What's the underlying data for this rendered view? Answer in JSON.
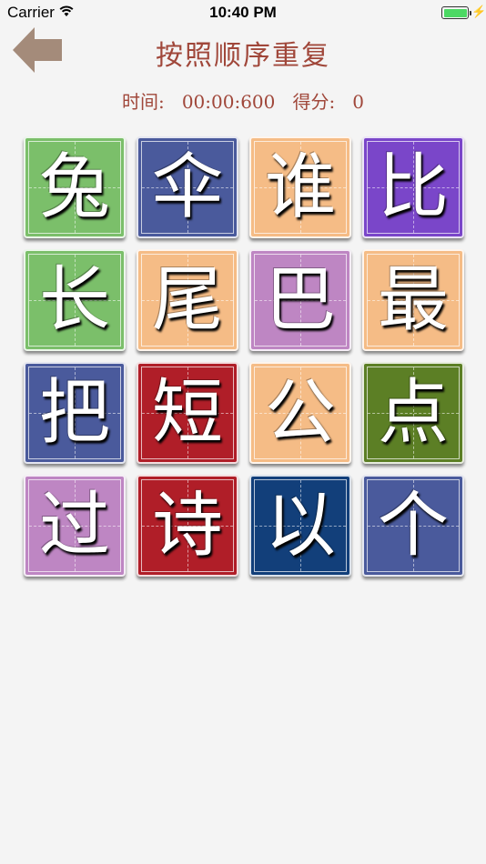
{
  "status_bar": {
    "carrier": "Carrier",
    "time": "10:40 PM"
  },
  "header": {
    "title": "按照顺序重复",
    "time_label": "时间:",
    "time_value": "00:00:600",
    "score_label": "得分:",
    "score_value": "0",
    "accent_color": "#a0473a",
    "back_arrow_color": "#a48b7a"
  },
  "tiles": [
    {
      "char": "兔",
      "color": "#7bbf6a"
    },
    {
      "char": "伞",
      "color": "#4a5a9c"
    },
    {
      "char": "谁",
      "color": "#f5bc86"
    },
    {
      "char": "比",
      "color": "#7a46c9"
    },
    {
      "char": "长",
      "color": "#7bbf6a"
    },
    {
      "char": "尾",
      "color": "#f5bc86"
    },
    {
      "char": "巴",
      "color": "#be86c3"
    },
    {
      "char": "最",
      "color": "#f5bc86"
    },
    {
      "char": "把",
      "color": "#4a5a9c"
    },
    {
      "char": "短",
      "color": "#b01e28"
    },
    {
      "char": "公",
      "color": "#f5bc86"
    },
    {
      "char": "点",
      "color": "#5c7f25"
    },
    {
      "char": "过",
      "color": "#be86c3"
    },
    {
      "char": "诗",
      "color": "#b01e28"
    },
    {
      "char": "以",
      "color": "#123f7a"
    },
    {
      "char": "个",
      "color": "#4a5a9c"
    }
  ]
}
